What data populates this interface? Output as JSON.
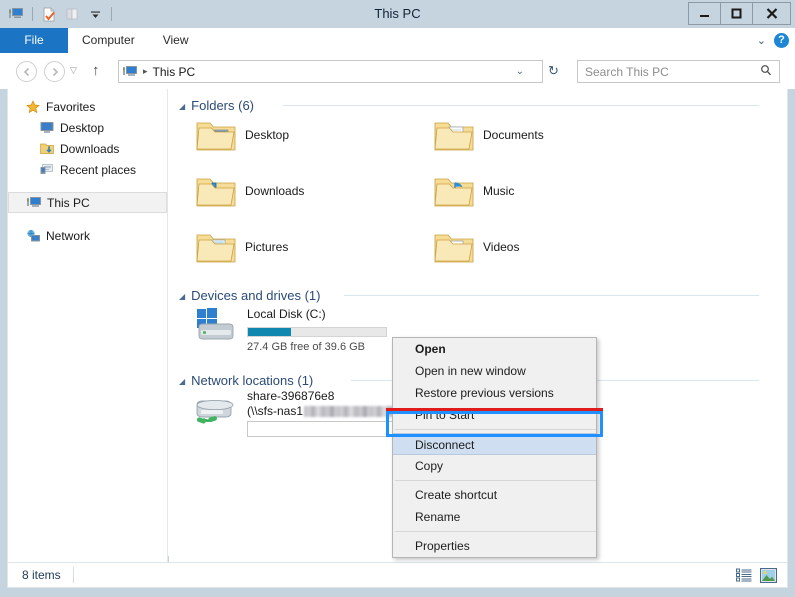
{
  "window": {
    "title": "This PC",
    "controls": {
      "minimize": "—",
      "maximize": "□",
      "close": "✕"
    },
    "quick_access": [
      "this-pc-icon",
      "properties-icon",
      "new-folder-icon",
      "customize-dropdown"
    ]
  },
  "ribbon": {
    "tabs": [
      {
        "label": "File",
        "active": true
      },
      {
        "label": "Computer",
        "active": false
      },
      {
        "label": "View",
        "active": false
      }
    ],
    "collapse_label": "⌄",
    "help_label": "?"
  },
  "addressbar": {
    "back_label": "◄",
    "forward_label": "►",
    "recent_label": "▽",
    "up_label": "↑",
    "path_text": "This PC",
    "path_separator": "▸",
    "dropdown_label": "⌄",
    "refresh_label": "↻"
  },
  "search": {
    "placeholder": "Search This PC",
    "icon": "search-icon"
  },
  "sidebar": {
    "items": [
      {
        "label": "Favorites",
        "icon": "star-icon",
        "level": 0,
        "selected": false
      },
      {
        "label": "Desktop",
        "icon": "desktop-icon",
        "level": 1,
        "selected": false
      },
      {
        "label": "Downloads",
        "icon": "downloads-folder-icon",
        "level": 1,
        "selected": false
      },
      {
        "label": "Recent places",
        "icon": "recent-places-icon",
        "level": 1,
        "selected": false
      },
      {
        "label": "This PC",
        "icon": "this-pc-icon",
        "level": 0,
        "selected": true
      },
      {
        "label": "Network",
        "icon": "network-icon",
        "level": 0,
        "selected": false
      }
    ]
  },
  "content": {
    "groups": [
      {
        "name": "folders",
        "header": "Folders (6)"
      },
      {
        "name": "devices",
        "header": "Devices and drives (1)"
      },
      {
        "name": "network",
        "header": "Network locations (1)"
      }
    ],
    "folders": [
      {
        "label": "Desktop",
        "icon": "desktop-folder-icon"
      },
      {
        "label": "Documents",
        "icon": "documents-folder-icon"
      },
      {
        "label": "Downloads",
        "icon": "downloads-folder-icon"
      },
      {
        "label": "Music",
        "icon": "music-folder-icon"
      },
      {
        "label": "Pictures",
        "icon": "pictures-folder-icon"
      },
      {
        "label": "Videos",
        "icon": "videos-folder-icon"
      }
    ],
    "drives": [
      {
        "label": "Local Disk (C:)",
        "icon": "local-disk-icon",
        "free_text": "27.4 GB free of 39.6 GB",
        "used_percent": 31,
        "bar_color": "#1087ae"
      }
    ],
    "network_locations": [
      {
        "label": "share-396876e8",
        "icon": "network-drive-icon",
        "path_prefix": "(\\\\sfs-nas1",
        "path_redacted": true
      }
    ]
  },
  "context_menu": {
    "items": [
      {
        "label": "Open",
        "bold": true,
        "highlighted": false,
        "separator_after": false
      },
      {
        "label": "Open in new window",
        "bold": false,
        "highlighted": false,
        "separator_after": false
      },
      {
        "label": "Restore previous versions",
        "bold": false,
        "highlighted": false,
        "separator_after": false
      },
      {
        "label": "Pin to Start",
        "bold": false,
        "highlighted": false,
        "separator_after": true
      },
      {
        "label": "Disconnect",
        "bold": false,
        "highlighted": true,
        "separator_after": false
      },
      {
        "label": "Copy",
        "bold": false,
        "highlighted": false,
        "separator_after": true
      },
      {
        "label": "Create shortcut",
        "bold": false,
        "highlighted": false,
        "separator_after": false
      },
      {
        "label": "Rename",
        "bold": false,
        "highlighted": false,
        "separator_after": true
      },
      {
        "label": "Properties",
        "bold": false,
        "highlighted": false,
        "separator_after": false
      }
    ],
    "annotation_color": "#1e90ff",
    "annotation_target": "Disconnect"
  },
  "statusbar": {
    "item_count": "8 items",
    "view_buttons": [
      {
        "icon": "details-view-icon",
        "active": false
      },
      {
        "icon": "large-icons-view-icon",
        "active": true
      }
    ]
  }
}
